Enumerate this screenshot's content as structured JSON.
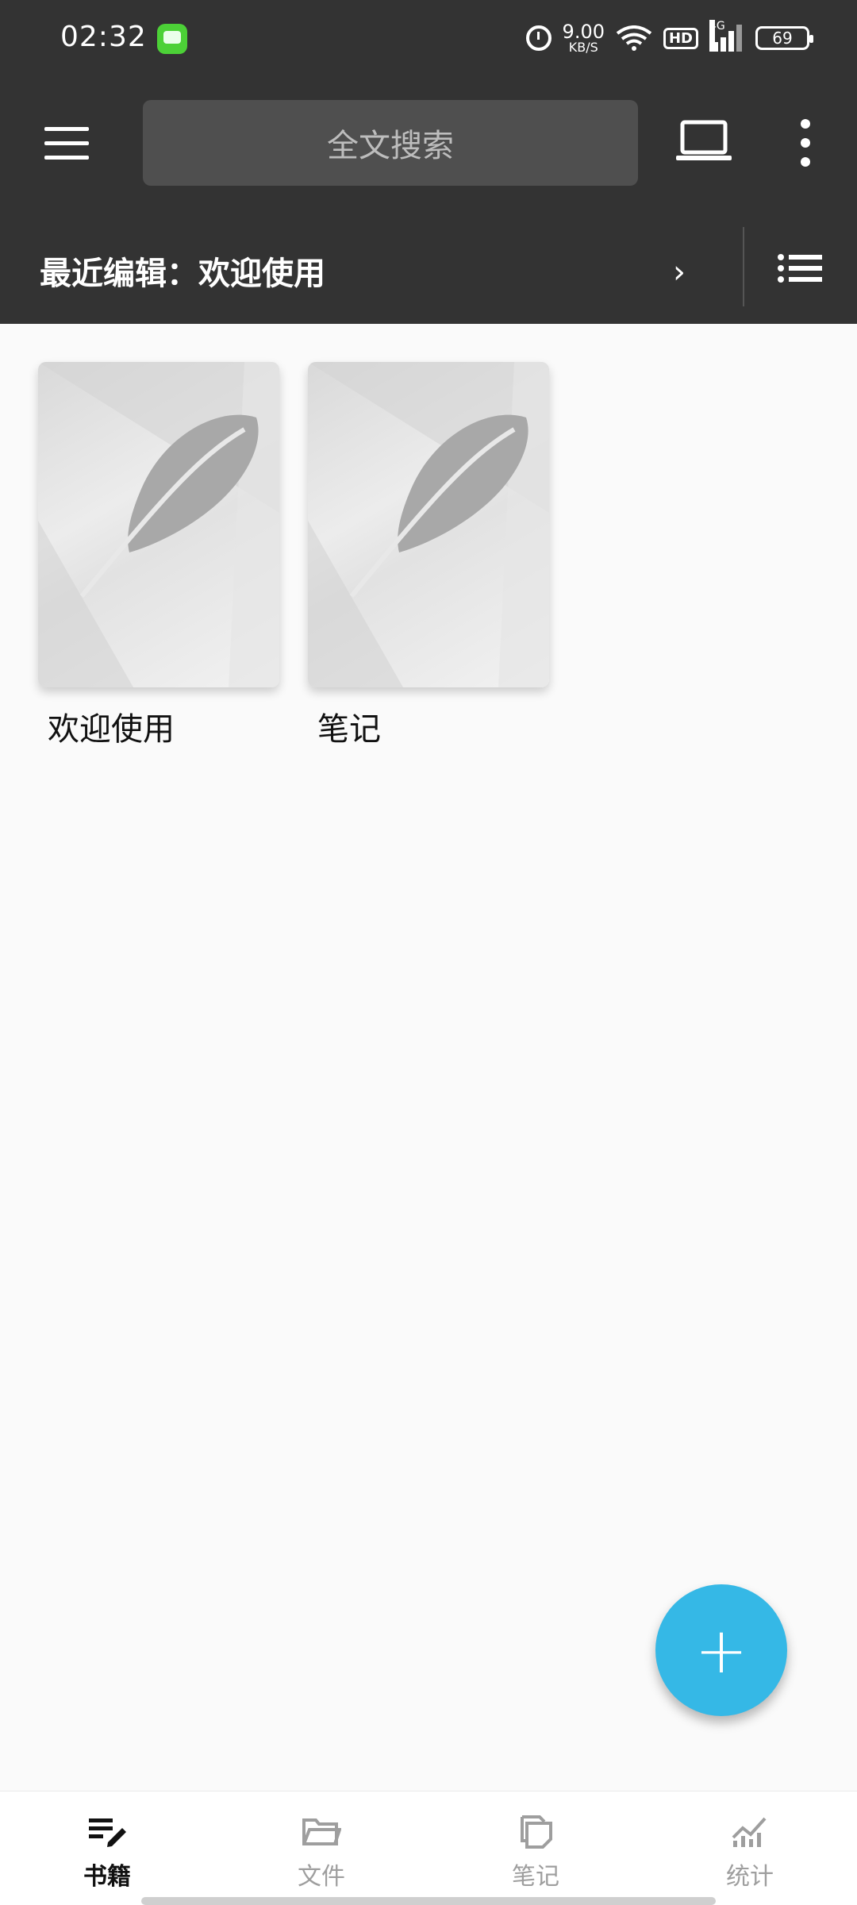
{
  "status_bar": {
    "time": "02:32",
    "speed_value": "9.00",
    "speed_unit": "KB/S",
    "hd_label": "HD",
    "network_label": "4G",
    "battery": "69"
  },
  "toolbar": {
    "search_placeholder": "全文搜索"
  },
  "recent": {
    "text": "最近编辑：欢迎使用",
    "chevron": "›"
  },
  "books": [
    {
      "title": "欢迎使用"
    },
    {
      "title": "笔记"
    }
  ],
  "fab": {
    "label": "+"
  },
  "bottom_nav": {
    "items": [
      {
        "label": "书籍",
        "active": true
      },
      {
        "label": "文件",
        "active": false
      },
      {
        "label": "笔记",
        "active": false
      },
      {
        "label": "统计",
        "active": false
      }
    ]
  },
  "colors": {
    "topbar": "#333333",
    "accent": "#35b8e6",
    "background": "#fafafa"
  }
}
